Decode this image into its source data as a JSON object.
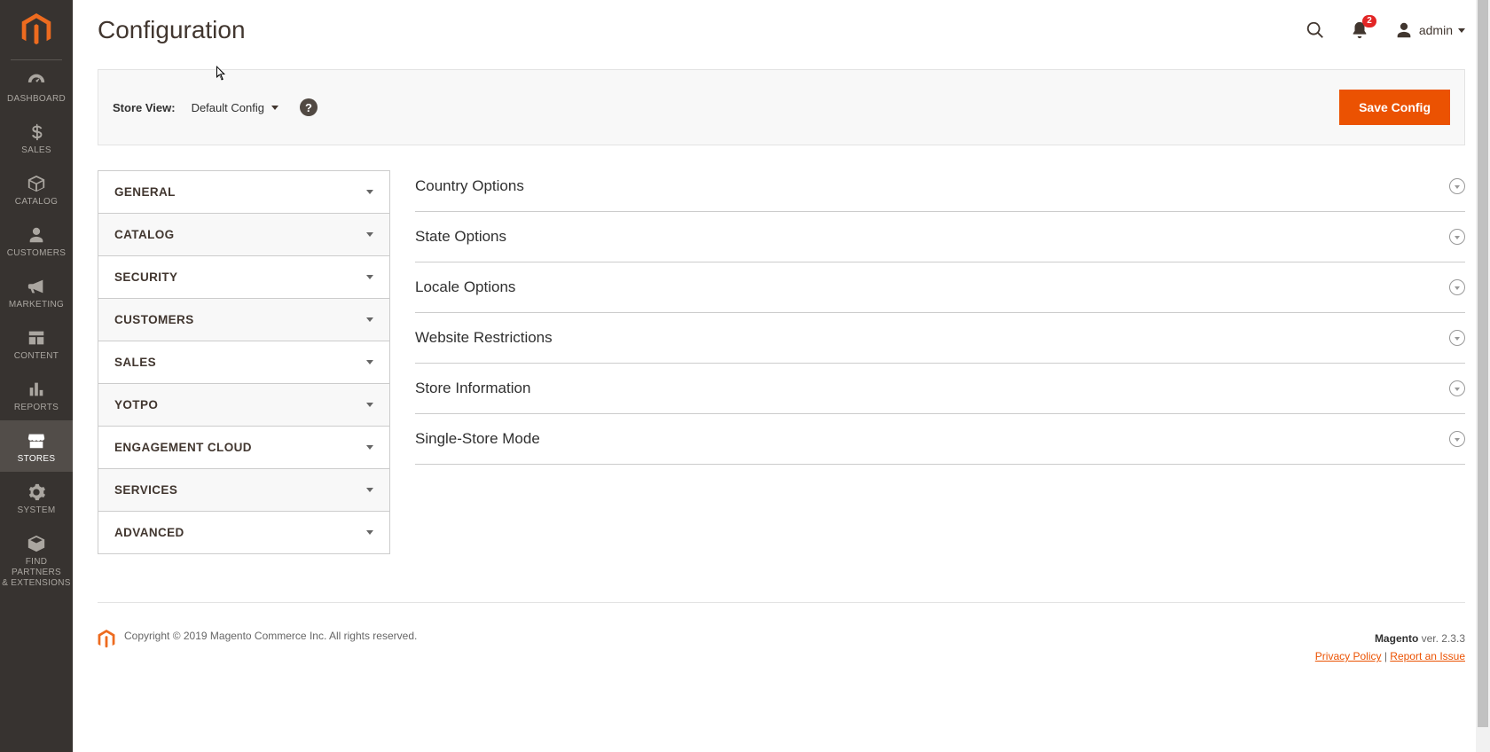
{
  "page": {
    "title": "Configuration"
  },
  "sidebar": {
    "items": [
      {
        "label": "DASHBOARD"
      },
      {
        "label": "SALES"
      },
      {
        "label": "CATALOG"
      },
      {
        "label": "CUSTOMERS"
      },
      {
        "label": "MARKETING"
      },
      {
        "label": "CONTENT"
      },
      {
        "label": "REPORTS"
      },
      {
        "label": "STORES"
      },
      {
        "label": "SYSTEM"
      },
      {
        "label": "FIND PARTNERS\n& EXTENSIONS"
      }
    ]
  },
  "header": {
    "notifications_count": "2",
    "user_label": "admin"
  },
  "scope": {
    "label": "Store View:",
    "value": "Default Config",
    "save_label": "Save Config"
  },
  "config_tabs": [
    {
      "label": "GENERAL"
    },
    {
      "label": "CATALOG"
    },
    {
      "label": "SECURITY"
    },
    {
      "label": "CUSTOMERS"
    },
    {
      "label": "SALES"
    },
    {
      "label": "YOTPO"
    },
    {
      "label": "ENGAGEMENT CLOUD"
    },
    {
      "label": "SERVICES"
    },
    {
      "label": "ADVANCED"
    }
  ],
  "sections": [
    {
      "title": "Country Options"
    },
    {
      "title": "State Options"
    },
    {
      "title": "Locale Options"
    },
    {
      "title": "Website Restrictions"
    },
    {
      "title": "Store Information"
    },
    {
      "title": "Single-Store Mode"
    }
  ],
  "footer": {
    "copyright": "Copyright © 2019 Magento Commerce Inc. All rights reserved.",
    "brand": "Magento",
    "version_prefix": " ver. ",
    "version": "2.3.3",
    "privacy": "Privacy Policy",
    "sep": " | ",
    "report": "Report an Issue"
  }
}
